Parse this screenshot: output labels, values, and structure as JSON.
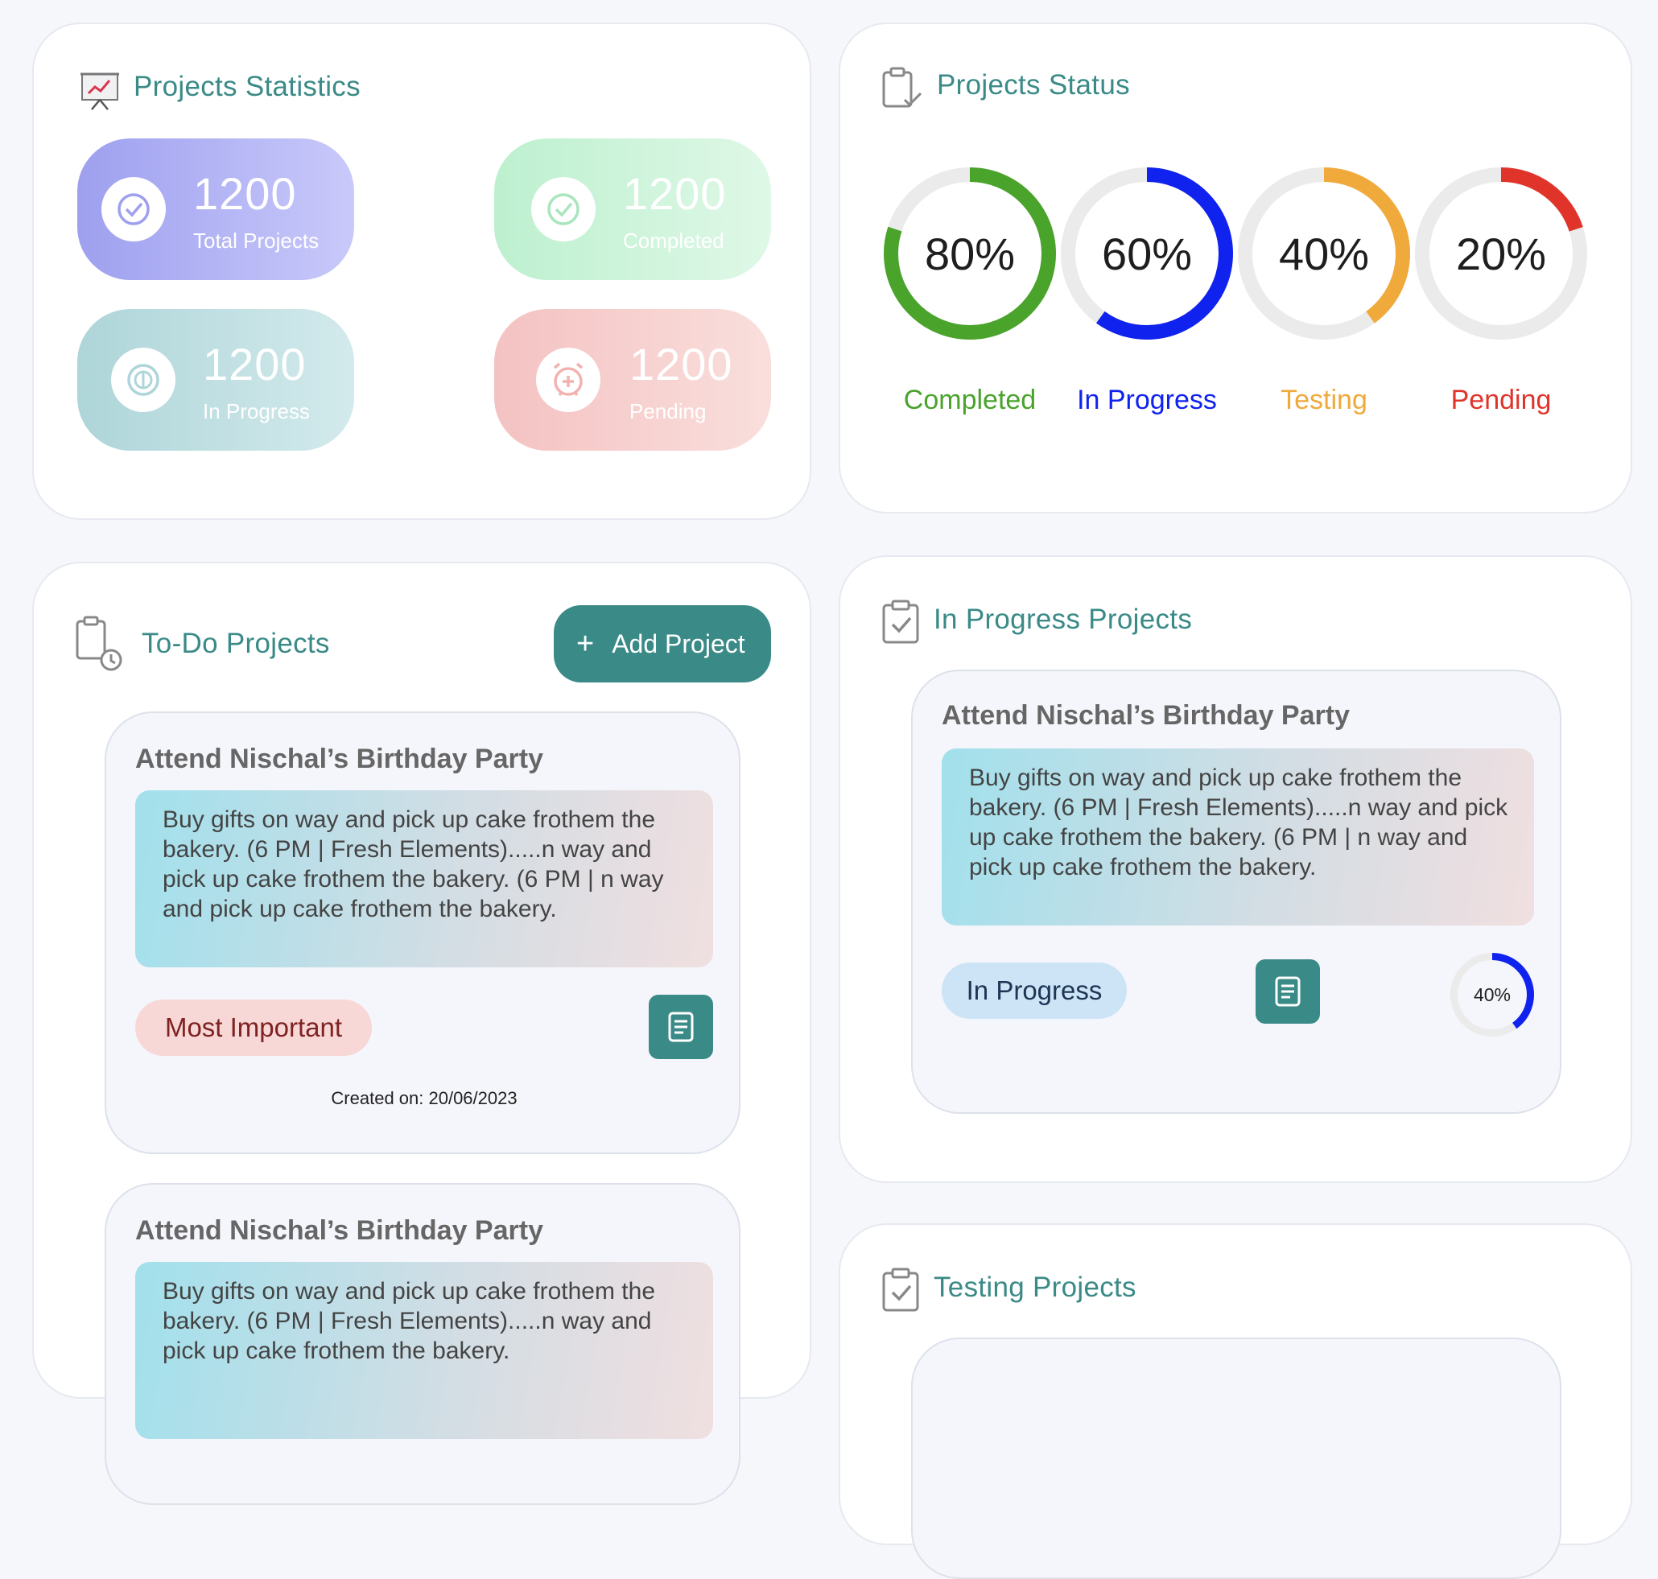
{
  "stats_card": {
    "title": "Projects Statistics",
    "items": [
      {
        "value": "1200",
        "label": "Total Projects"
      },
      {
        "value": "1200",
        "label": "Completed"
      },
      {
        "value": "1200",
        "label": "In Progress"
      },
      {
        "value": "1200",
        "label": "Pending"
      }
    ]
  },
  "status_card": {
    "title": "Projects Status",
    "donuts": [
      {
        "percent_text": "80%",
        "value": 0.8,
        "label": "Completed",
        "color": "#4aa32b"
      },
      {
        "percent_text": "60%",
        "value": 0.6,
        "label": "In Progress",
        "color": "#1022ee"
      },
      {
        "percent_text": "40%",
        "value": 0.4,
        "label": "Testing",
        "color": "#f0a93b"
      },
      {
        "percent_text": "20%",
        "value": 0.2,
        "label": "Pending",
        "color": "#e0342b"
      }
    ]
  },
  "todo_card": {
    "title": "To-Do Projects",
    "add_button": "Add Project",
    "projects": [
      {
        "title": "Attend Nischal’s Birthday Party",
        "description": "Buy gifts on way and pick up cake frothem the bakery. (6 PM | Fresh Elements).....n way and pick up cake frothem the bakery. (6 PM | n way and pick up cake frothem the bakery.",
        "priority": "Most Important",
        "created": "Created on: 20/06/2023"
      },
      {
        "title": "Attend Nischal’s Birthday Party",
        "description": "Buy gifts on way and pick up cake frothem the bakery. (6 PM | Fresh Elements).....n way and pick up cake frothem the bakery."
      }
    ]
  },
  "inprogress_card": {
    "title": "In Progress Projects",
    "project": {
      "title": "Attend Nischal’s Birthday Party",
      "description": "Buy gifts on way and pick up cake frothem the bakery. (6 PM | Fresh Elements).....n way and pick up cake frothem the bakery. (6 PM | n way and pick up cake frothem the bakery.",
      "status": "In Progress",
      "progress_text": "40%",
      "progress": 0.4
    }
  },
  "testing_card": {
    "title": "Testing Projects"
  },
  "colors": {
    "accent": "#3a8a87",
    "completed": "#4aa32b",
    "in_progress": "#1022ee",
    "testing": "#f0a93b",
    "pending": "#e0342b"
  }
}
